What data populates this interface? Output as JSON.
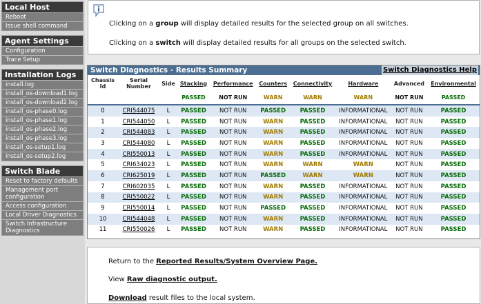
{
  "sidebar": {
    "local_host": {
      "title": "Local Host",
      "items": [
        "Reboot",
        "Issue shell command"
      ]
    },
    "agent_settings": {
      "title": "Agent Settings",
      "items": [
        "Configuration",
        "Trace Setup"
      ]
    },
    "installation_logs": {
      "title": "Installation Logs",
      "items": [
        "install.log",
        "install_os-download1.log",
        "install_os-download2.log",
        "install_os-phase0.log",
        "install_os-phase1.log",
        "install_os-phase2.log",
        "install_os-phase3.log",
        "install_os-setup1.log",
        "install_os-setup2.log"
      ]
    },
    "switch_blade": {
      "title": "Switch Blade",
      "items": [
        "Reset to factory defaults",
        "Management port configuration",
        "Access configuration",
        "Local Driver Diagnostics",
        "Switch Infrastructure Diagnostics"
      ]
    }
  },
  "info": {
    "line1_pre": "Clicking on a ",
    "line1_bold": "group",
    "line1_post": " will display detailed results for the selected group on all switches.",
    "line2_pre": "Clicking on a ",
    "line2_bold": "switch",
    "line2_post": " will display detailed results for all groups on the selected switch."
  },
  "panel": {
    "title": "Switch Diagnostics - Results Summary",
    "help": "Switch Diagnostics Help",
    "headers": [
      "Chassis Id",
      "Serial Number",
      "Side",
      "Stacking",
      "Performance",
      "Counters",
      "Connectivity",
      "Hardware",
      "Advanced",
      "Environmental"
    ],
    "summary": [
      "",
      "",
      "",
      "PASSED",
      "NOT RUN",
      "WARN",
      "WARN",
      "WARN",
      "NOT RUN",
      "PASSED"
    ],
    "rows": [
      [
        "0",
        "CRI544075",
        "L",
        "PASSED",
        "NOT RUN",
        "PASSED",
        "PASSED",
        "INFORMATIONAL",
        "NOT RUN",
        "PASSED"
      ],
      [
        "1",
        "CRI544050",
        "L",
        "PASSED",
        "NOT RUN",
        "WARN",
        "PASSED",
        "INFORMATIONAL",
        "NOT RUN",
        "PASSED"
      ],
      [
        "2",
        "CRI544083",
        "L",
        "PASSED",
        "NOT RUN",
        "WARN",
        "PASSED",
        "INFORMATIONAL",
        "NOT RUN",
        "PASSED"
      ],
      [
        "3",
        "CRI544080",
        "L",
        "PASSED",
        "NOT RUN",
        "WARN",
        "PASSED",
        "INFORMATIONAL",
        "NOT RUN",
        "PASSED"
      ],
      [
        "4",
        "CRI550013",
        "L",
        "PASSED",
        "NOT RUN",
        "WARN",
        "PASSED",
        "INFORMATIONAL",
        "NOT RUN",
        "PASSED"
      ],
      [
        "5",
        "CRI634023",
        "L",
        "PASSED",
        "NOT RUN",
        "WARN",
        "WARN",
        "WARN",
        "NOT RUN",
        "PASSED"
      ],
      [
        "6",
        "CRI625019",
        "L",
        "PASSED",
        "NOT RUN",
        "PASSED",
        "WARN",
        "WARN",
        "NOT RUN",
        "PASSED"
      ],
      [
        "7",
        "CRI602035",
        "L",
        "PASSED",
        "NOT RUN",
        "WARN",
        "PASSED",
        "INFORMATIONAL",
        "NOT RUN",
        "PASSED"
      ],
      [
        "8",
        "CRI550022",
        "L",
        "PASSED",
        "NOT RUN",
        "WARN",
        "PASSED",
        "INFORMATIONAL",
        "NOT RUN",
        "PASSED"
      ],
      [
        "9",
        "CRI550014",
        "L",
        "PASSED",
        "NOT RUN",
        "PASSED",
        "PASSED",
        "INFORMATIONAL",
        "NOT RUN",
        "PASSED"
      ],
      [
        "10",
        "CRI544048",
        "L",
        "PASSED",
        "NOT RUN",
        "WARN",
        "PASSED",
        "INFORMATIONAL",
        "NOT RUN",
        "PASSED"
      ],
      [
        "11",
        "CRI550026",
        "L",
        "PASSED",
        "NOT RUN",
        "WARN",
        "PASSED",
        "INFORMATIONAL",
        "NOT RUN",
        "PASSED"
      ]
    ]
  },
  "bottom": {
    "l1_pre": "Return to the ",
    "l1_link": "Reported Results/System Overview Page.",
    "l2_pre": "View ",
    "l2_link": "Raw diagnostic output.",
    "l3_link": "Download",
    "l3_post": " result files to the local system."
  },
  "colors": {
    "header": "#4b6e92",
    "pass": "#0a6b0a",
    "warn": "#a07a00",
    "row_alt": "#dde8f4"
  }
}
